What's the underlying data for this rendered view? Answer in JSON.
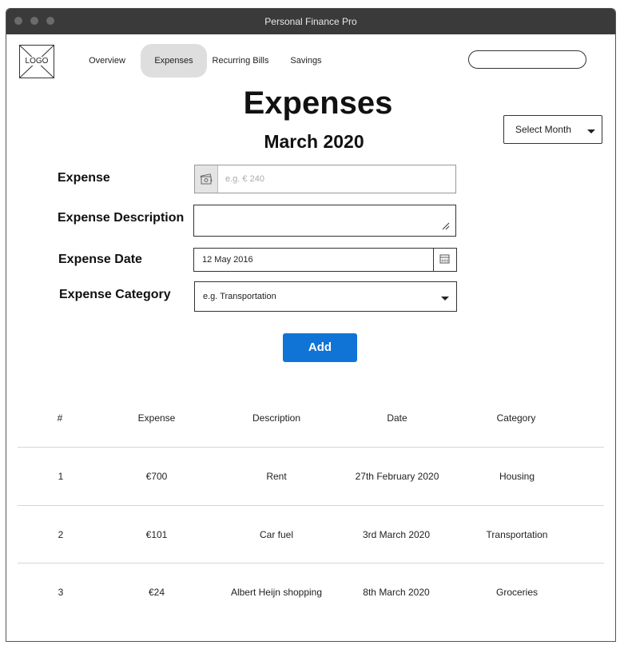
{
  "window": {
    "title": "Personal Finance Pro"
  },
  "logo": {
    "label": "LOGO"
  },
  "nav": {
    "items": [
      {
        "label": "Overview"
      },
      {
        "label": "Expenses"
      },
      {
        "label": "Recurring Bills"
      },
      {
        "label": "Savings"
      }
    ],
    "active": "Expenses"
  },
  "search": {
    "value": "",
    "placeholder": ""
  },
  "page": {
    "title": "Expenses",
    "subtitle": "March 2020"
  },
  "month_select": {
    "label": "Select Month"
  },
  "form": {
    "expense": {
      "label": "Expense",
      "placeholder": "e.g. € 240"
    },
    "description": {
      "label": "Expense Description",
      "value": ""
    },
    "date": {
      "label": "Expense Date",
      "value": "12 May 2016"
    },
    "category": {
      "label": "Expense Category",
      "value": "e.g. Transportation"
    },
    "add_label": "Add"
  },
  "table": {
    "headers": [
      "#",
      "Expense",
      "Description",
      "Date",
      "Category"
    ],
    "rows": [
      [
        "1",
        "€700",
        "Rent",
        "27th February 2020",
        "Housing"
      ],
      [
        "2",
        "€101",
        "Car fuel",
        "3rd March 2020",
        "Transportation"
      ],
      [
        "3",
        "€24",
        "Albert Heijn shopping",
        "8th March 2020",
        "Groceries"
      ]
    ]
  },
  "colors": {
    "accent": "#0f74d6",
    "titlebar": "#3a3a3a",
    "active_tab": "#dedede"
  },
  "icons": {
    "search": "magnifier-icon",
    "expense_addon": "money-icon",
    "date": "calendar-icon",
    "dropdown": "caret-down-icon"
  }
}
